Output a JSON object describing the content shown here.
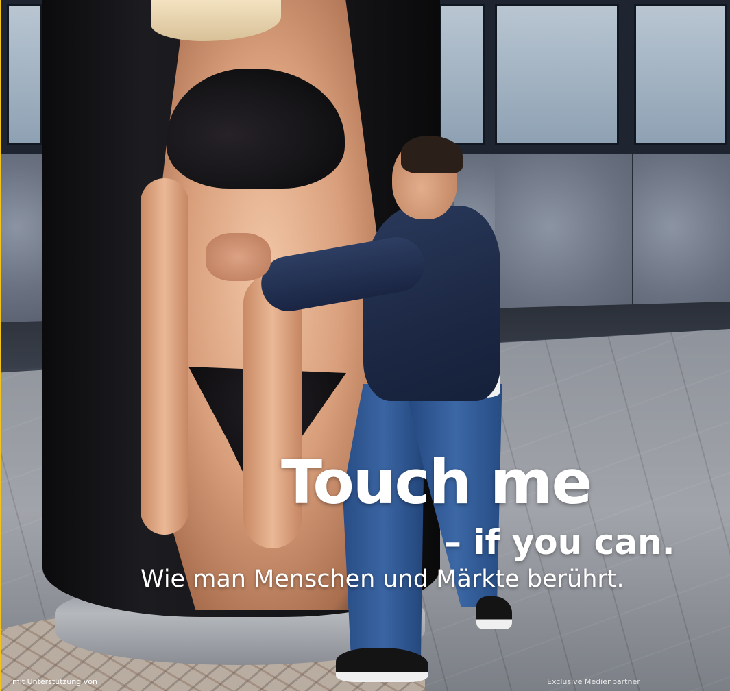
{
  "headline": {
    "title": "Touch me",
    "subtitle": "– if you can.",
    "tagline": "Wie man Menschen und Märkte berührt."
  },
  "footer": {
    "left_text": "mit Unterstützung von",
    "right_text": "Exclusive Medienpartner"
  },
  "colors": {
    "headline_text": "#ffffff",
    "accent_edge": "#f3c21b"
  }
}
